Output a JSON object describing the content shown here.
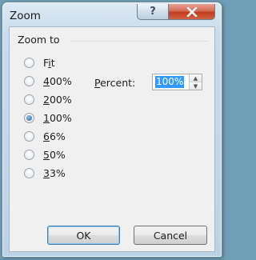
{
  "window": {
    "title": "Zoom",
    "help_label": "?",
    "close_label": "✕"
  },
  "group": {
    "label": "Zoom to"
  },
  "options": [
    {
      "label": "Fit",
      "mnemonic": "i",
      "selected": false
    },
    {
      "label": "400%",
      "mnemonic": "4",
      "selected": false
    },
    {
      "label": "200%",
      "mnemonic": "2",
      "selected": false
    },
    {
      "label": "100%",
      "mnemonic": "1",
      "selected": true
    },
    {
      "label": "66%",
      "mnemonic": "6",
      "selected": false
    },
    {
      "label": "50%",
      "mnemonic": "5",
      "selected": false
    },
    {
      "label": "33%",
      "mnemonic": "3",
      "selected": false
    }
  ],
  "percent": {
    "label": "Percent:",
    "value": "100%",
    "up": "▲",
    "down": "▼"
  },
  "buttons": {
    "ok": "OK",
    "cancel": "Cancel"
  }
}
